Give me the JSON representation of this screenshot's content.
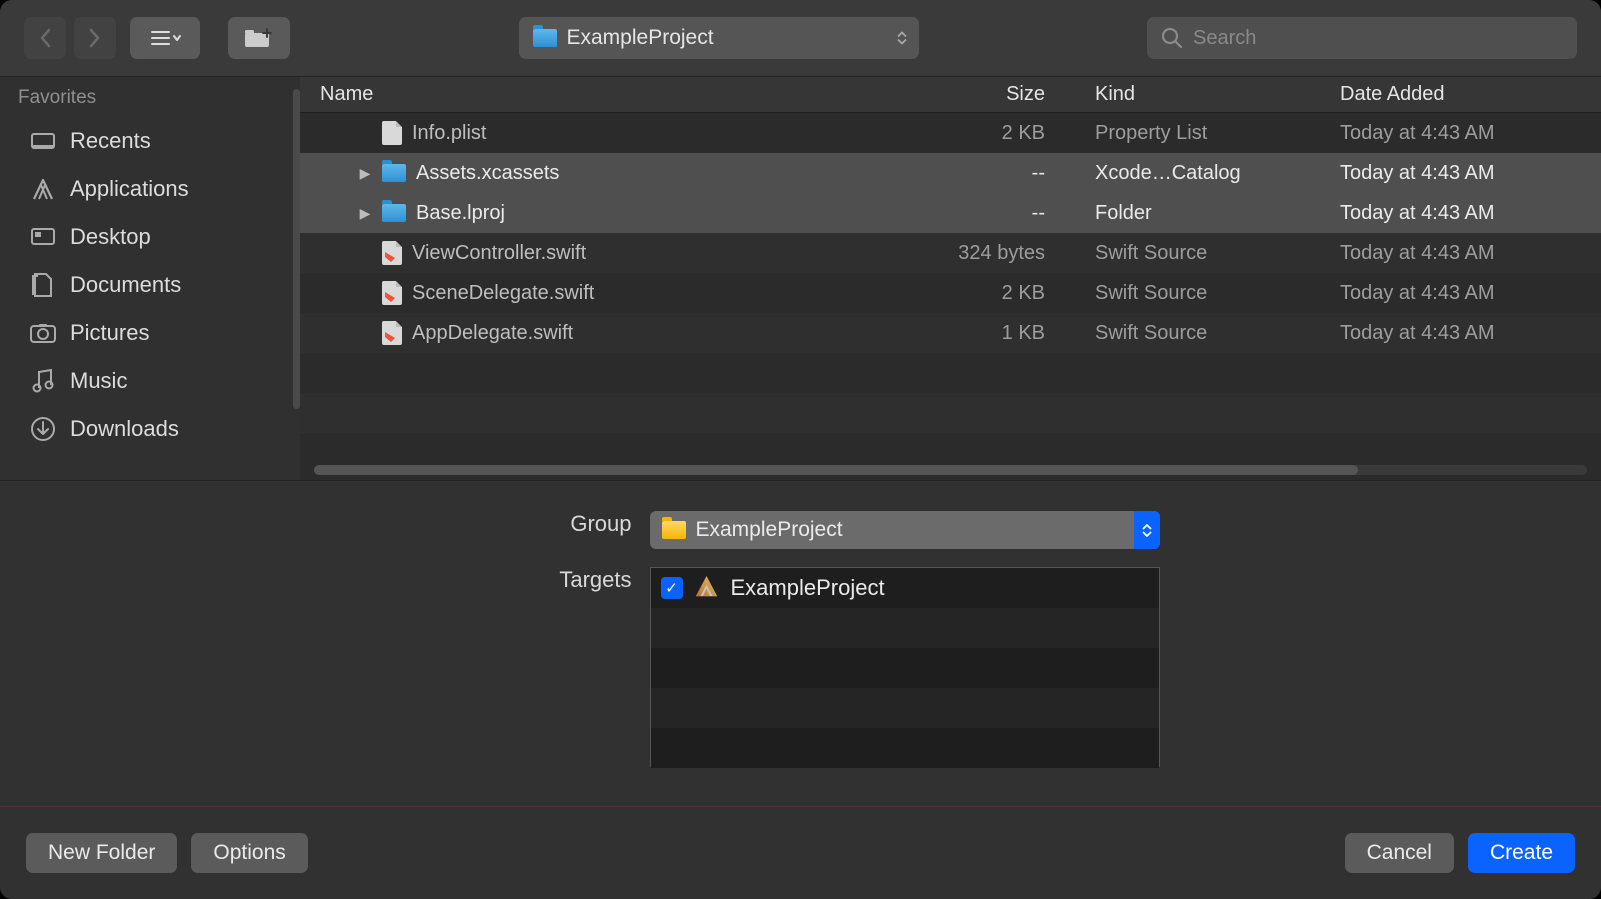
{
  "toolbar": {
    "path_label": "ExampleProject",
    "search_placeholder": "Search"
  },
  "sidebar": {
    "heading": "Favorites",
    "items": [
      {
        "label": "Recents",
        "icon": "recents-icon"
      },
      {
        "label": "Applications",
        "icon": "applications-icon"
      },
      {
        "label": "Desktop",
        "icon": "desktop-icon"
      },
      {
        "label": "Documents",
        "icon": "documents-icon"
      },
      {
        "label": "Pictures",
        "icon": "pictures-icon"
      },
      {
        "label": "Music",
        "icon": "music-icon"
      },
      {
        "label": "Downloads",
        "icon": "downloads-icon"
      }
    ]
  },
  "columns": {
    "name": "Name",
    "size": "Size",
    "kind": "Kind",
    "date": "Date Added"
  },
  "files": [
    {
      "name": "Info.plist",
      "size": "2 KB",
      "kind": "Property List",
      "date": "Today at 4:43 AM",
      "type": "plist",
      "folder": false,
      "disclosure": false,
      "selected": false
    },
    {
      "name": "Assets.xcassets",
      "size": "--",
      "kind": "Xcode…Catalog",
      "date": "Today at 4:43 AM",
      "type": "folder",
      "folder": true,
      "disclosure": true,
      "selected": true
    },
    {
      "name": "Base.lproj",
      "size": "--",
      "kind": "Folder",
      "date": "Today at 4:43 AM",
      "type": "folder",
      "folder": true,
      "disclosure": true,
      "selected": true
    },
    {
      "name": "ViewController.swift",
      "size": "324 bytes",
      "kind": "Swift Source",
      "date": "Today at 4:43 AM",
      "type": "swift",
      "folder": false,
      "disclosure": false,
      "selected": false
    },
    {
      "name": "SceneDelegate.swift",
      "size": "2 KB",
      "kind": "Swift Source",
      "date": "Today at 4:43 AM",
      "type": "swift",
      "folder": false,
      "disclosure": false,
      "selected": false
    },
    {
      "name": "AppDelegate.swift",
      "size": "1 KB",
      "kind": "Swift Source",
      "date": "Today at 4:43 AM",
      "type": "swift",
      "folder": false,
      "disclosure": false,
      "selected": false
    }
  ],
  "form": {
    "group_label": "Group",
    "group_value": "ExampleProject",
    "targets_label": "Targets",
    "targets": [
      {
        "name": "ExampleProject",
        "checked": true
      }
    ]
  },
  "buttons": {
    "new_folder": "New Folder",
    "options": "Options",
    "cancel": "Cancel",
    "create": "Create"
  }
}
